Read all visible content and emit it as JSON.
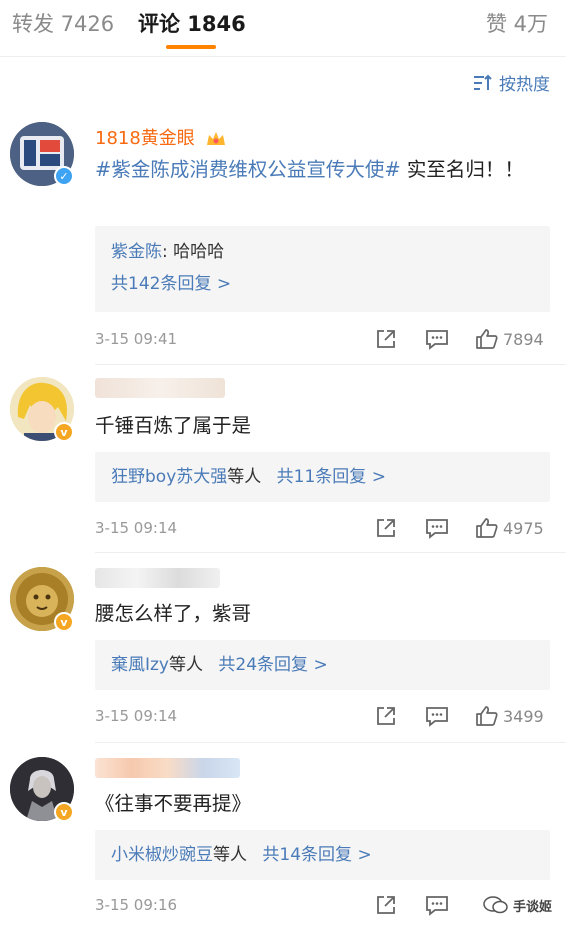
{
  "tabs": [
    {
      "label": "转发 7426"
    },
    {
      "label": "评论 1846"
    },
    {
      "label": "赞 4万"
    }
  ],
  "accent_color": "#ff8200",
  "link_color": "#4a7bb8",
  "sort": {
    "label": "按热度",
    "icon": "sort-icon"
  },
  "comments": [
    {
      "username": "1818黄金眼",
      "text_topic": "#紫金陈成消费维权公益宣传大使#",
      "text_rest": " 实至名归！！",
      "reply_preview": {
        "user": "紫金陈",
        "text": ": 哈哈哈"
      },
      "reply_count_label": "共142条回复 >",
      "time": "3-15 09:41",
      "likes": "7894"
    },
    {
      "text": "千锤百炼了属于是",
      "reply_users": "狂野boy苏大强",
      "reply_suffix": "等人",
      "reply_count_label": "共11条回复 >",
      "time": "3-15 09:14",
      "likes": "4975"
    },
    {
      "text": "腰怎么样了，紫哥",
      "reply_users": "棄風Izy",
      "reply_suffix": "等人",
      "reply_count_label": "共24条回复 >",
      "time": "3-15 09:14",
      "likes": "3499"
    },
    {
      "text": "《往事不要再提》",
      "reply_users": "小米椒炒豌豆",
      "reply_suffix": "等人",
      "reply_count_label": "共14条回复 >",
      "time": "3-15 09:16",
      "likes": ""
    }
  ],
  "watermark": {
    "label": "手谈姬"
  }
}
